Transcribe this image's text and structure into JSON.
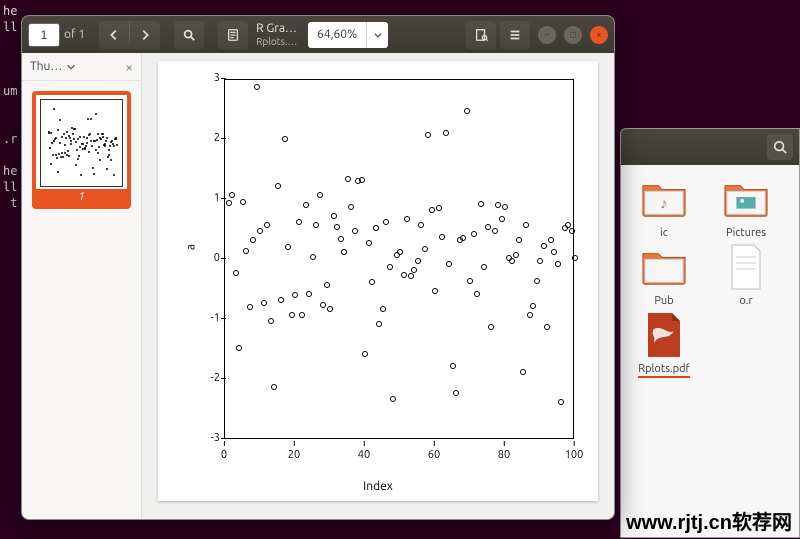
{
  "bg_terminal": "he\nll\n \n \n \num\n \n \n.r\n \nhe\nll\n t",
  "file_manager": {
    "items": [
      {
        "label": "ic",
        "type": "folder-music"
      },
      {
        "label": "Pictures",
        "type": "folder-pictures"
      },
      {
        "label": "Pub",
        "type": "folder"
      },
      {
        "label": "o.r",
        "type": "file"
      },
      {
        "label": "Rplots.pdf",
        "type": "pdf",
        "selected": true
      }
    ]
  },
  "pdf_viewer": {
    "page_input": "1",
    "page_total": "of 1",
    "title": "R Gra…",
    "subtitle": "Rplots.…",
    "zoom": "64,60%",
    "thumbs_title": "Thu…",
    "thumb_number": "1"
  },
  "chart_data": {
    "type": "scatter",
    "xlabel": "Index",
    "ylabel": "a",
    "xlim": [
      0,
      100
    ],
    "ylim": [
      -3,
      3
    ],
    "xticks": [
      0,
      20,
      40,
      60,
      80,
      100
    ],
    "yticks": [
      -3,
      -2,
      -1,
      0,
      1,
      2,
      3
    ],
    "x": [
      1,
      2,
      3,
      4,
      5,
      6,
      7,
      8,
      9,
      10,
      11,
      12,
      13,
      14,
      15,
      16,
      17,
      18,
      19,
      20,
      21,
      22,
      23,
      24,
      25,
      26,
      27,
      28,
      29,
      30,
      31,
      32,
      33,
      34,
      35,
      36,
      37,
      38,
      39,
      40,
      41,
      42,
      43,
      44,
      45,
      46,
      47,
      48,
      49,
      50,
      51,
      52,
      53,
      54,
      55,
      56,
      57,
      58,
      59,
      60,
      61,
      62,
      63,
      64,
      65,
      66,
      67,
      68,
      69,
      70,
      71,
      72,
      73,
      74,
      75,
      76,
      77,
      78,
      79,
      80,
      81,
      82,
      83,
      84,
      85,
      86,
      87,
      88,
      89,
      90,
      91,
      92,
      93,
      94,
      95,
      96,
      97,
      98,
      99,
      100
    ],
    "y": [
      0.92,
      1.05,
      -0.25,
      -1.5,
      0.94,
      0.12,
      -0.82,
      0.3,
      2.85,
      0.45,
      -0.75,
      0.55,
      -1.05,
      -2.15,
      1.2,
      -0.7,
      1.98,
      0.18,
      -0.95,
      -0.62,
      0.6,
      -0.95,
      0.88,
      -0.6,
      0.02,
      0.55,
      1.05,
      -0.78,
      -0.45,
      -0.85,
      0.7,
      0.52,
      0.32,
      0.1,
      1.32,
      0.85,
      0.45,
      1.28,
      1.3,
      -1.6,
      0.25,
      -0.4,
      0.5,
      -1.1,
      -0.85,
      0.6,
      -0.15,
      -2.35,
      0.05,
      0.1,
      -0.28,
      0.65,
      -0.3,
      -0.2,
      -0.05,
      0.55,
      0.15,
      2.05,
      0.8,
      -0.55,
      0.83,
      0.35,
      2.08,
      -0.1,
      -1.8,
      -2.25,
      0.3,
      0.33,
      2.45,
      -0.38,
      0.4,
      -0.6,
      0.9,
      -0.15,
      0.52,
      -1.15,
      0.45,
      0.88,
      0.65,
      0.85,
      0.0,
      -0.05,
      0.05,
      0.3,
      -1.9,
      0.55,
      -0.95,
      -0.8,
      -0.38,
      -0.05,
      0.2,
      -1.15,
      0.3,
      0.1,
      -0.1,
      -2.4,
      0.5,
      0.55,
      0.45,
      0.0
    ]
  },
  "watermark": "www.rjtj.cn软荐网"
}
